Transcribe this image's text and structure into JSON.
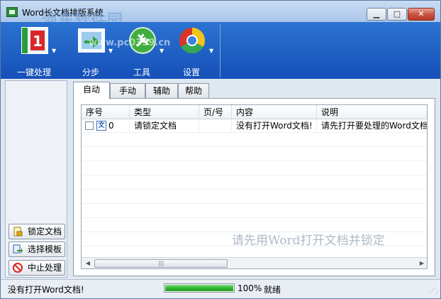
{
  "window": {
    "title": "Word长文档排版系统",
    "watermark": "河东软件园",
    "watermark_url": "www.pc0359.cn"
  },
  "toolbar": {
    "items": [
      {
        "label": "一键处理",
        "icon": "one-click-icon"
      },
      {
        "label": "分步",
        "icon": "step-icon"
      },
      {
        "label": "工具",
        "icon": "tools-icon"
      },
      {
        "label": "设置",
        "icon": "settings-icon"
      }
    ]
  },
  "side_buttons": [
    {
      "label": "锁定文档",
      "icon": "lock-document-icon"
    },
    {
      "label": "选择模板",
      "icon": "select-template-icon"
    },
    {
      "label": "中止处理",
      "icon": "stop-icon"
    }
  ],
  "tabs": [
    "自动",
    "手动",
    "辅助",
    "帮助"
  ],
  "grid": {
    "columns": [
      "序号",
      "类型",
      "页/号",
      "内容",
      "说明"
    ],
    "rows": [
      {
        "index": "0",
        "type": "请锁定文档",
        "page": "",
        "content": "没有打开Word文档!",
        "note": "请先打开要处理的Word文档"
      }
    ],
    "hint": "请先用Word打开文档并锁定"
  },
  "status": {
    "message": "没有打开Word文档!",
    "progress": 100,
    "progress_text": "100%",
    "state": "就绪"
  },
  "colors": {
    "toolbar": "#1e5fc4",
    "progress": "#2fb32f",
    "close": "#c9503d"
  }
}
